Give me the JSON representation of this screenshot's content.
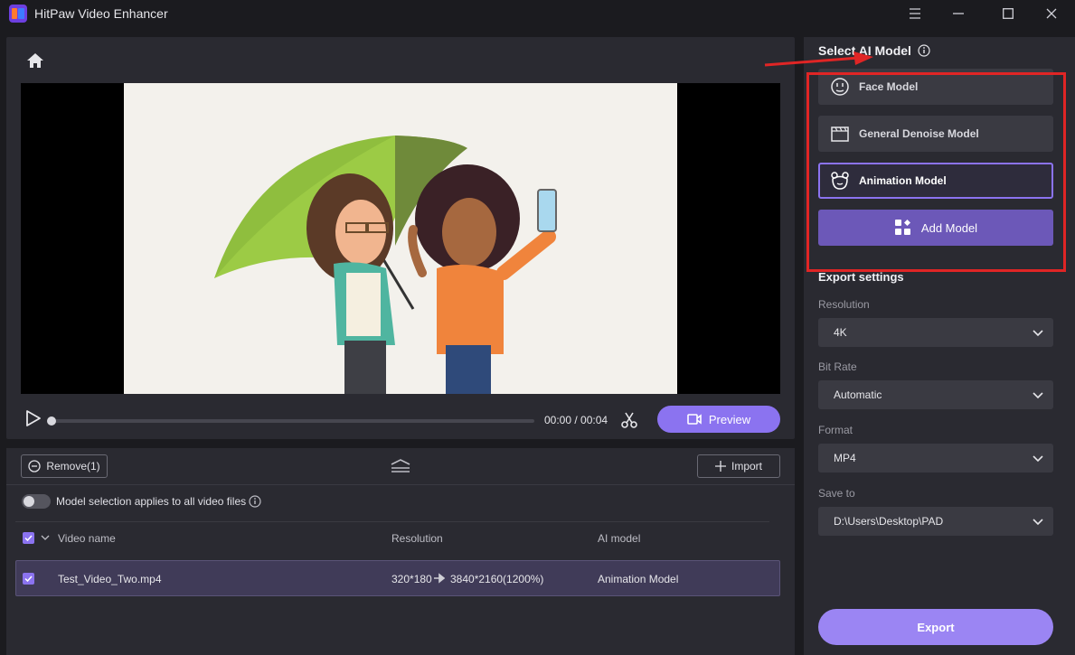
{
  "app": {
    "title": "HitPaw Video Enhancer"
  },
  "player": {
    "time": "00:00 / 00:04",
    "preview_label": "Preview",
    "progress": 0
  },
  "file_list": {
    "remove_label": "Remove(1)",
    "import_label": "Import",
    "apply_all_label": "Model selection applies to all video files",
    "columns": {
      "name": "Video name",
      "resolution": "Resolution",
      "model": "AI model"
    },
    "rows": [
      {
        "name": "Test_Video_Two.mp4",
        "resolution_from": "320*180",
        "resolution_to": "3840*2160(1200%)",
        "model": "Animation Model"
      }
    ]
  },
  "ai_model": {
    "title": "Select AI Model",
    "models": [
      {
        "label": "Face Model",
        "icon": "face-icon"
      },
      {
        "label": "General Denoise Model",
        "icon": "clapperboard-icon"
      },
      {
        "label": "Animation Model",
        "icon": "bear-icon",
        "selected": true
      }
    ],
    "add_label": "Add Model"
  },
  "export": {
    "title": "Export settings",
    "resolution_label": "Resolution",
    "resolution_value": "4K",
    "bitrate_label": "Bit Rate",
    "bitrate_value": "Automatic",
    "format_label": "Format",
    "format_value": "MP4",
    "saveto_label": "Save to",
    "saveto_value": "D:\\Users\\Desktop\\PAD",
    "export_label": "Export"
  },
  "colors": {
    "accent": "#8b73f0",
    "annotation": "#e02525"
  }
}
